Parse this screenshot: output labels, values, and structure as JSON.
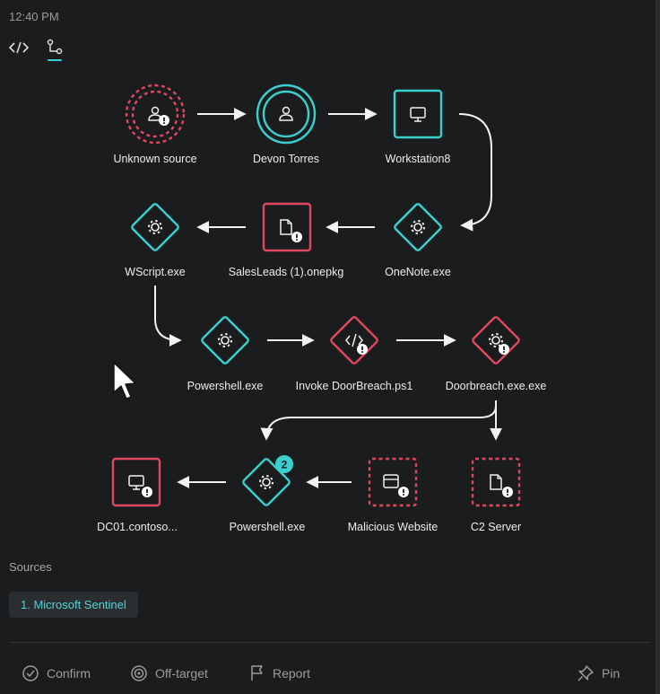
{
  "header": {
    "time": "12:40 PM"
  },
  "tabs": [
    {
      "icon": "code-icon",
      "active": false
    },
    {
      "icon": "graph-icon",
      "active": true
    }
  ],
  "graph": {
    "nodes": [
      {
        "id": "unknown-source",
        "label": "Unknown source",
        "kind": "user",
        "status": "unknown"
      },
      {
        "id": "devon-torres",
        "label": "Devon Torres",
        "kind": "user",
        "status": "normal"
      },
      {
        "id": "workstation8",
        "label": "Workstation8",
        "kind": "device",
        "status": "normal"
      },
      {
        "id": "onenote",
        "label": "OneNote.exe",
        "kind": "process",
        "status": "normal"
      },
      {
        "id": "salesleads",
        "label": "SalesLeads (1).onepkg",
        "kind": "file",
        "status": "malicious"
      },
      {
        "id": "wscript",
        "label": "WScript.exe",
        "kind": "process",
        "status": "normal"
      },
      {
        "id": "powershell1",
        "label": "Powershell.exe",
        "kind": "process",
        "status": "normal"
      },
      {
        "id": "invoke",
        "label": "Invoke DoorBreach.ps1",
        "kind": "script",
        "status": "malicious"
      },
      {
        "id": "doorbreach",
        "label": "Doorbreach.exe.exe",
        "kind": "process",
        "status": "malicious"
      },
      {
        "id": "c2",
        "label": "C2 Server",
        "kind": "file",
        "status": "suspicious"
      },
      {
        "id": "website",
        "label": "Malicious Website",
        "kind": "web",
        "status": "suspicious"
      },
      {
        "id": "powershell2",
        "label": "Powershell.exe",
        "kind": "process",
        "status": "normal",
        "badge": "2"
      },
      {
        "id": "dc01",
        "label": "DC01.contoso...",
        "kind": "device",
        "status": "malicious"
      }
    ]
  },
  "sources": {
    "title": "Sources",
    "items": [
      "1. Microsoft Sentinel"
    ]
  },
  "footer": {
    "confirm": "Confirm",
    "off_target": "Off-target",
    "report": "Report",
    "pin": "Pin"
  },
  "colors": {
    "background": "#1b1c1e",
    "teal": "#3ad0d0",
    "red": "#e0485f",
    "text": "#ededed"
  }
}
